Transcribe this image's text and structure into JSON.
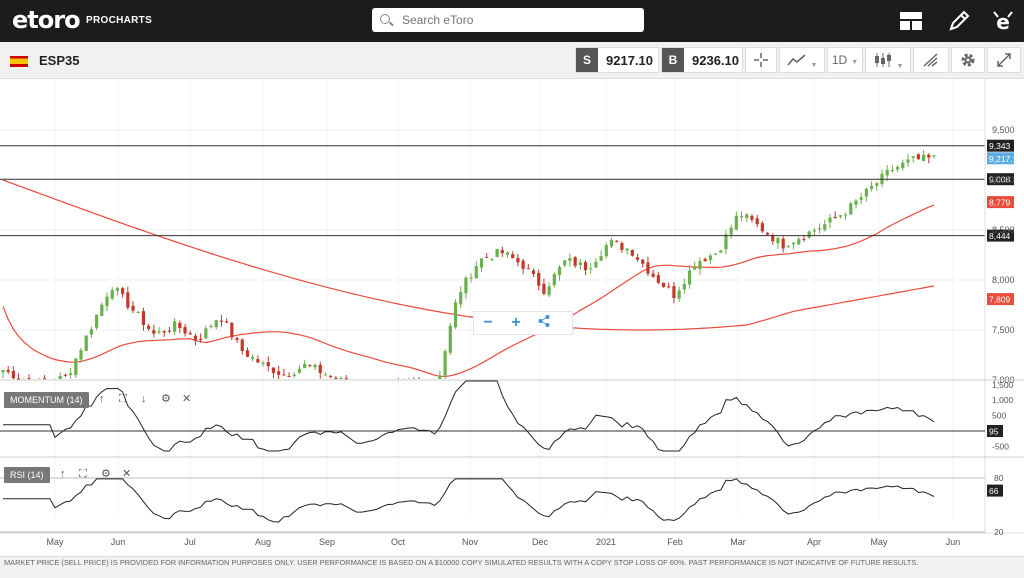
{
  "header": {
    "logo": "etoro",
    "logo_sub": "PROCHARTS",
    "search_placeholder": "Search eToro"
  },
  "instrument": {
    "name": "ESP35",
    "sell_tag": "S",
    "sell_price": "9217.10",
    "buy_tag": "B",
    "buy_price": "9236.10"
  },
  "toolbar": {
    "interval": "1D"
  },
  "price_axis": {
    "ticks": [
      "9,500",
      "9,000",
      "8,500",
      "8,000",
      "7,500",
      "7,000"
    ]
  },
  "price_lines": [
    {
      "label": "9,343",
      "value": 9343,
      "style": "black"
    },
    {
      "label": "9,008",
      "value": 9008,
      "style": "black"
    },
    {
      "label": "8,444",
      "value": 8444,
      "style": "black"
    }
  ],
  "tags": {
    "current": "9,217.10",
    "ma_fast": "8,779",
    "ma_slow": "7,809"
  },
  "momentum": {
    "label": "MOMENTUM (14)",
    "ticks": [
      "1,500",
      "1,000",
      "500",
      "0",
      "-500"
    ],
    "value": "95"
  },
  "rsi": {
    "label": "RSI (14)",
    "ticks": [
      "80",
      "20"
    ],
    "value": "66"
  },
  "time_axis": [
    "May",
    "Jun",
    "Jul",
    "Aug",
    "Sep",
    "Oct",
    "Nov",
    "Dec",
    "2021",
    "Feb",
    "Mar",
    "Apr",
    "May",
    "Jun"
  ],
  "footer": "MARKET PRICE (SELL PRICE) IS PROVIDED FOR INFORMATION PURPOSES ONLY. USER PERFORMANCE IS BASED ON A $10000 COPY SIMULATED RESULTS WITH A COPY STOP LOSS OF 60%. PAST PERFORMANCE IS NOT INDICATIVE OF FUTURE RESULTS.",
  "colors": {
    "up": "#6ab04c",
    "down": "#c0392b",
    "ma": "#e74c3c",
    "current": "#5dade2",
    "dark": "#1c1c1c"
  },
  "chart_data": {
    "type": "line",
    "series": [
      {
        "values": [
          7100,
          7000,
          6950,
          7050,
          7500,
          7950,
          7700,
          7450,
          7550,
          7400,
          7650,
          7300,
          7150,
          7050,
          7150,
          7050,
          6950,
          6900,
          6950,
          6950,
          6900,
          7850,
          8200,
          8280,
          8150,
          7900,
          8200,
          8120,
          8380,
          8300,
          8050,
          7850,
          8180,
          8280,
          8670,
          8520,
          8350,
          8450,
          8560,
          8700,
          8900,
          9100,
          9200,
          9217
        ]
      }
    ]
  }
}
